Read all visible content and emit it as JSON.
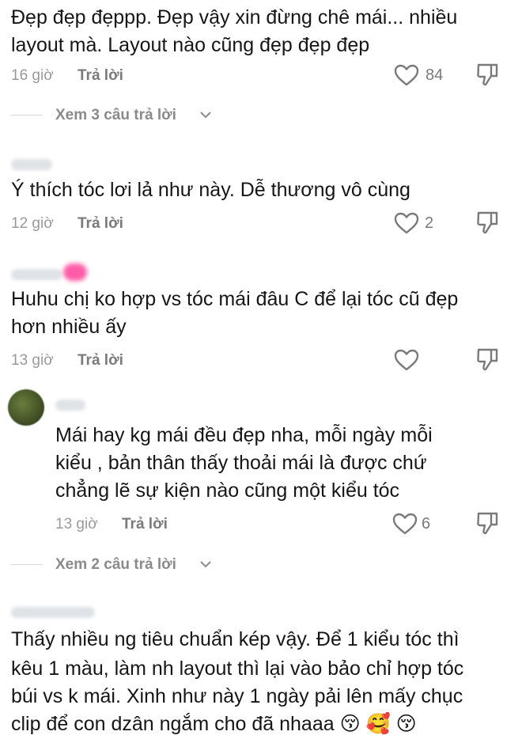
{
  "comments": [
    {
      "lines": [
        "Đẹp đẹp đẹppp. Đẹp vậy xin đừng chê mái... nhiều",
        "layout mà. Layout nào cũng đẹp đẹp đẹp"
      ],
      "time": "16 giờ",
      "reply_label": "Trả lời",
      "likes": "84",
      "view_replies": "Xem 3 câu trả lời"
    },
    {
      "lines": [
        "Ý thích tóc lơi lả như này. Dễ thương vô cùng"
      ],
      "time": "12 giờ",
      "reply_label": "Trả lời",
      "likes": "2"
    },
    {
      "lines": [
        "Huhu chị ko hợp vs tóc mái đâu C để lại tóc cũ đẹp",
        "hơn nhiều ấy"
      ],
      "time": "13 giờ",
      "reply_label": "Trả lời",
      "likes": ""
    },
    {
      "lines": [
        "Mái hay kg mái đều đẹp nha, mỗi ngày mỗi",
        "kiểu , bản thân thấy thoải mái là được chứ",
        "chẳng lẽ sự kiện nào cũng một kiểu tóc"
      ],
      "time": "13 giờ",
      "reply_label": "Trả lời",
      "likes": "6",
      "view_replies": "Xem 2 câu trả lời"
    },
    {
      "lines": [
        "Thấy nhiều ng tiêu chuẩn kép vậy. Để 1 kiểu tóc thì",
        "kêu 1 màu, làm nh layout thì lại vào bảo chỉ hợp tóc",
        "búi vs k mái. Xinh như này 1 ngày pải lên mấy chục",
        "clip để con dzân ngắm cho đã nhaaa 😚 🥰 😚"
      ]
    }
  ],
  "icons": {
    "like": "heart-outline-icon",
    "dislike": "thumbs-down-icon",
    "expand": "chevron-down-icon"
  }
}
